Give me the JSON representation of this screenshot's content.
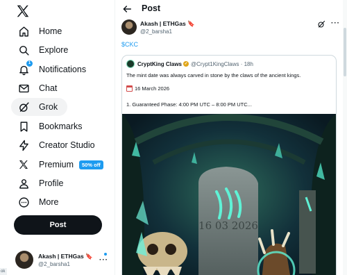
{
  "nav": {
    "items": [
      {
        "label": "Home",
        "icon": "home-icon"
      },
      {
        "label": "Explore",
        "icon": "search-icon"
      },
      {
        "label": "Notifications",
        "icon": "bell-icon",
        "badge": "1"
      },
      {
        "label": "Chat",
        "icon": "mail-icon"
      },
      {
        "label": "Grok",
        "icon": "grok-icon"
      },
      {
        "label": "Bookmarks",
        "icon": "bookmark-icon"
      },
      {
        "label": "Creator Studio",
        "icon": "lightning-icon"
      },
      {
        "label": "Premium",
        "icon": "x-logo-icon",
        "tag": "50% off"
      },
      {
        "label": "Profile",
        "icon": "person-icon"
      },
      {
        "label": "More",
        "icon": "more-circle-icon"
      }
    ],
    "post_button": "Post"
  },
  "account": {
    "name": "Akash | ETHGas 🔖",
    "handle": "@2_barsha1"
  },
  "header": {
    "title": "Post"
  },
  "post": {
    "author_name": "Akash | ETHGas 🔖",
    "author_handle": "@2_barsha1",
    "text": "$CKC",
    "quote": {
      "name": "CryptKing Claws",
      "handle_time": "@Crypt1KingClaws · 18h",
      "line1": "The mint date was always carved in stone by the claws of the ancient kings.",
      "date": "16 March 2026",
      "phase": "1. Guaranteed Phase: 4:00 PM UTC – 8:00 PM UTC...",
      "image_text": "16 03 2026"
    }
  },
  "misc": {
    "corner_tag": "ok"
  },
  "colors": {
    "accent": "#1d9bf0",
    "text": "#0f1419",
    "muted": "#536471"
  }
}
